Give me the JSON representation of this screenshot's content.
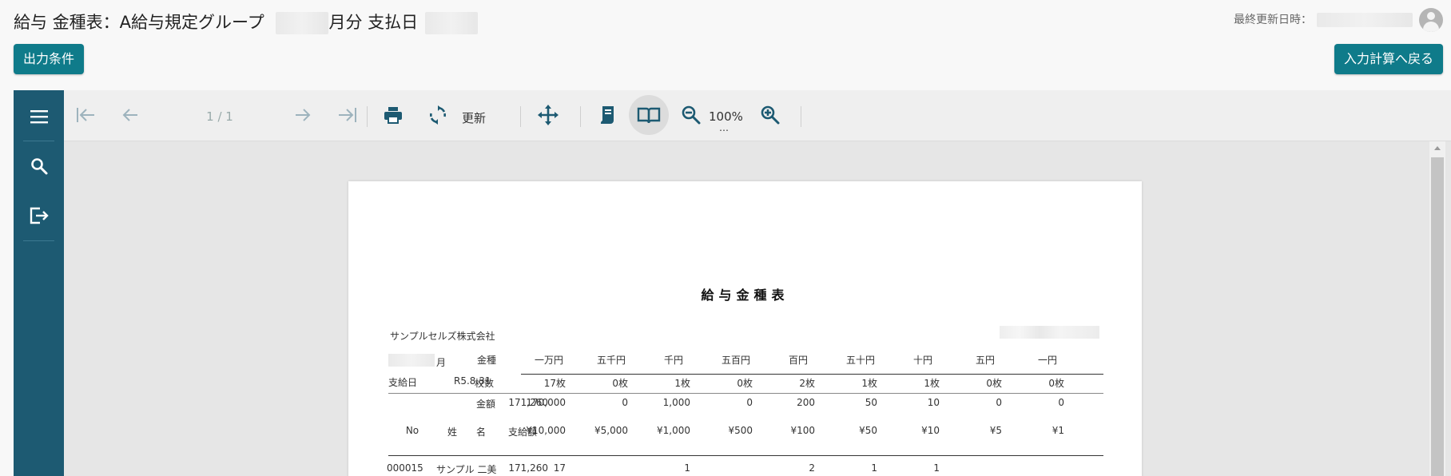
{
  "header": {
    "title_prefix": "給与 金種表：A給与規定グループ",
    "title_month": "月分 支払日",
    "last_updated_label": "最終更新日時："
  },
  "buttons": {
    "output_conditions": "出力条件",
    "back_to_input": "入力計算へ戻る"
  },
  "toolbar": {
    "page_indicator": "1 / 1",
    "refresh_label": "更新",
    "zoom": "100%",
    "zoom_more": "…"
  },
  "report": {
    "title": "給与金種表",
    "company": "サンプルセルズ株式会社",
    "month_suffix": "月",
    "pay_date_label": "支給日",
    "pay_date_value": "R5.8.31",
    "denom_header": [
      "金種",
      "一万円",
      "五千円",
      "千円",
      "五百円",
      "百円",
      "五十円",
      "十円",
      "五円",
      "一円"
    ],
    "count_row": [
      "枚数",
      "17枚",
      "0枚",
      "1枚",
      "0枚",
      "2枚",
      "1枚",
      "1枚",
      "0枚",
      "0枚"
    ],
    "amount_label": "金額",
    "amount_row": [
      "171,260",
      "170,000",
      "0",
      "1,000",
      "0",
      "200",
      "50",
      "10",
      "0",
      "0"
    ],
    "detail_header": {
      "no": "No",
      "name": "姓　　名",
      "pay": "支給額",
      "denoms": [
        "¥10,000",
        "¥5,000",
        "¥1,000",
        "¥500",
        "¥100",
        "¥50",
        "¥10",
        "¥5",
        "¥1"
      ]
    },
    "detail_rows": [
      {
        "no": "000015",
        "name": "サンプル 二美",
        "pay": "171,260",
        "counts": [
          "17",
          "",
          "1",
          "",
          "2",
          "1",
          "1",
          "",
          ""
        ]
      }
    ]
  },
  "colors": {
    "primary_button": "#0f7b8a",
    "sidebar": "#1d5a72",
    "icon": "#1d5a72"
  },
  "icons": [
    "menu-icon",
    "search-icon",
    "export-icon",
    "first-page-icon",
    "prev-page-icon",
    "next-page-icon",
    "last-page-icon",
    "print-icon",
    "refresh-icon",
    "pan-icon",
    "continuous-scroll-icon",
    "book-view-icon",
    "zoom-out-icon",
    "zoom-in-icon",
    "user-avatar-icon"
  ]
}
